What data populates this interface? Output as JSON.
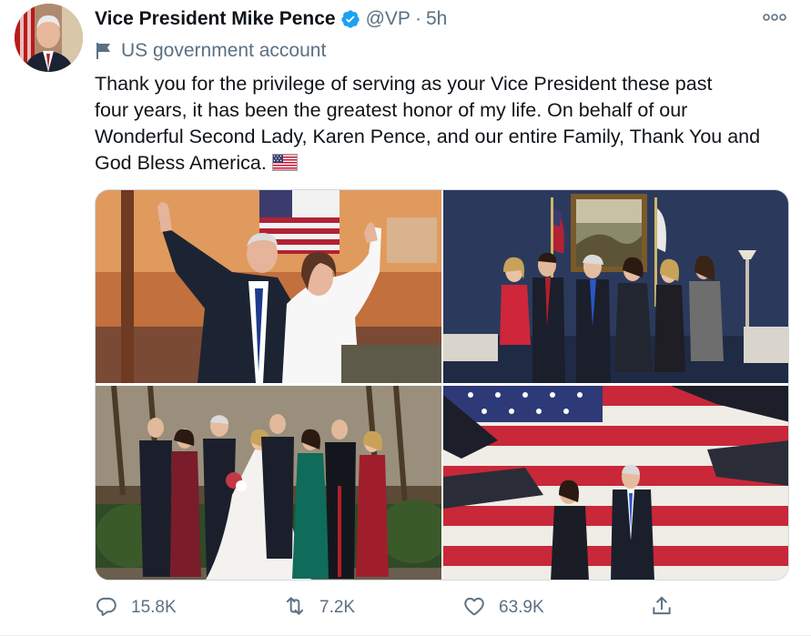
{
  "tweet": {
    "author": {
      "name": "Vice President Mike Pence",
      "handle": "@VP",
      "separator": "·",
      "time": "5h",
      "label": "US government account",
      "verified": true
    },
    "text_lines": [
      "Thank you for the privilege of serving as your Vice President these past",
      "four years, it has been the greatest honor of my life. On behalf of our",
      "Wonderful Second Lady, Karen Pence, and our entire Family, Thank You and",
      "God Bless America."
    ],
    "emoji": "flag-united-states",
    "photos": [
      {
        "name": "photo-waving-couple"
      },
      {
        "name": "photo-family-office"
      },
      {
        "name": "photo-wedding-family"
      },
      {
        "name": "photo-flag-stage"
      }
    ],
    "actions": {
      "reply_count": "15.8K",
      "retweet_count": "7.2K",
      "like_count": "63.9K"
    }
  },
  "colors": {
    "text": "#0f1419",
    "secondary": "#5b7083",
    "verified": "#1da1f2",
    "border": "#cfd9de"
  },
  "icons": [
    "verified-icon",
    "more-icon",
    "government-flag-icon",
    "reply-icon",
    "retweet-icon",
    "like-icon",
    "share-icon"
  ]
}
